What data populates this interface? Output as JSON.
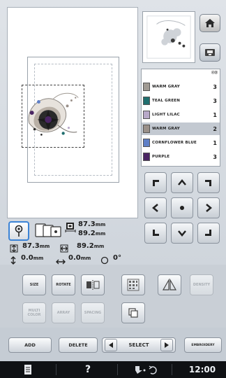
{
  "thread_list": {
    "header": "ⒶⒷ",
    "items": [
      {
        "name": "WARM GRAY",
        "count": "3",
        "swatch": "#a09a93"
      },
      {
        "name": "TEAL GREEN",
        "count": "3",
        "swatch": "#1f6e6e"
      },
      {
        "name": "LIGHT LILAC",
        "count": "1",
        "swatch": "#b8a9c9"
      },
      {
        "name": "WARM GRAY",
        "count": "2",
        "swatch": "#9a9089"
      },
      {
        "name": "CORNFLOWER BLUE",
        "count": "1",
        "swatch": "#5f7fc7"
      },
      {
        "name": "PURPLE",
        "count": "3",
        "swatch": "#4a2563"
      }
    ]
  },
  "info": {
    "size_w": "87.3",
    "size_h": "89.2",
    "unit": "mm",
    "width_label_val": "87.3",
    "height_label_val": "89.2",
    "move_x": "0.0",
    "move_y": "0.0",
    "angle": "0°"
  },
  "buttons": {
    "size": "SIZE",
    "rotate": "ROTATE",
    "density": "DENSITY",
    "multi_color": "MULTI COLOR",
    "array": "ARRAY",
    "spacing": "SPACING"
  },
  "bottom": {
    "add": "ADD",
    "delete": "DELETE",
    "select": "SELECT",
    "embroidery": "EMBROIDERY"
  },
  "status": {
    "help": "?",
    "time": "12:00"
  }
}
